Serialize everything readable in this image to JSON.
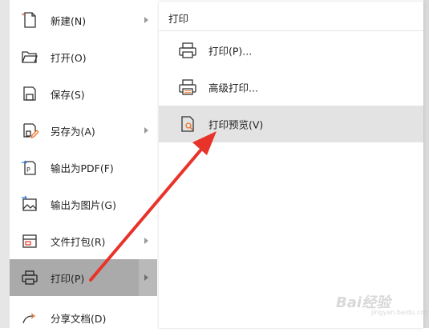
{
  "menu": {
    "items": [
      {
        "label": "新建(N)",
        "icon": "new-file-icon",
        "has_submenu": true
      },
      {
        "label": "打开(O)",
        "icon": "folder-open-icon",
        "has_submenu": false
      },
      {
        "label": "保存(S)",
        "icon": "save-icon",
        "has_submenu": false
      },
      {
        "label": "另存为(A)",
        "icon": "save-as-icon",
        "has_submenu": true
      },
      {
        "label": "输出为PDF(F)",
        "icon": "export-pdf-icon",
        "has_submenu": false
      },
      {
        "label": "输出为图片(G)",
        "icon": "export-image-icon",
        "has_submenu": false
      },
      {
        "label": "文件打包(R)",
        "icon": "package-icon",
        "has_submenu": true
      },
      {
        "label": "打印(P)",
        "icon": "printer-icon",
        "has_submenu": true,
        "active": true
      },
      {
        "label": "分享文档(D)",
        "icon": "share-icon",
        "has_submenu": false
      }
    ]
  },
  "submenu": {
    "title": "打印",
    "items": [
      {
        "label": "打印(P)...",
        "icon": "printer-icon"
      },
      {
        "label": "高级打印...",
        "icon": "advanced-printer-icon"
      },
      {
        "label": "打印预览(V)",
        "icon": "print-preview-icon",
        "hover": true
      }
    ]
  },
  "annotation": {
    "color": "#e8332a"
  },
  "watermark": {
    "text": "Bai经验",
    "sub": "jingyan.baidu.com"
  }
}
